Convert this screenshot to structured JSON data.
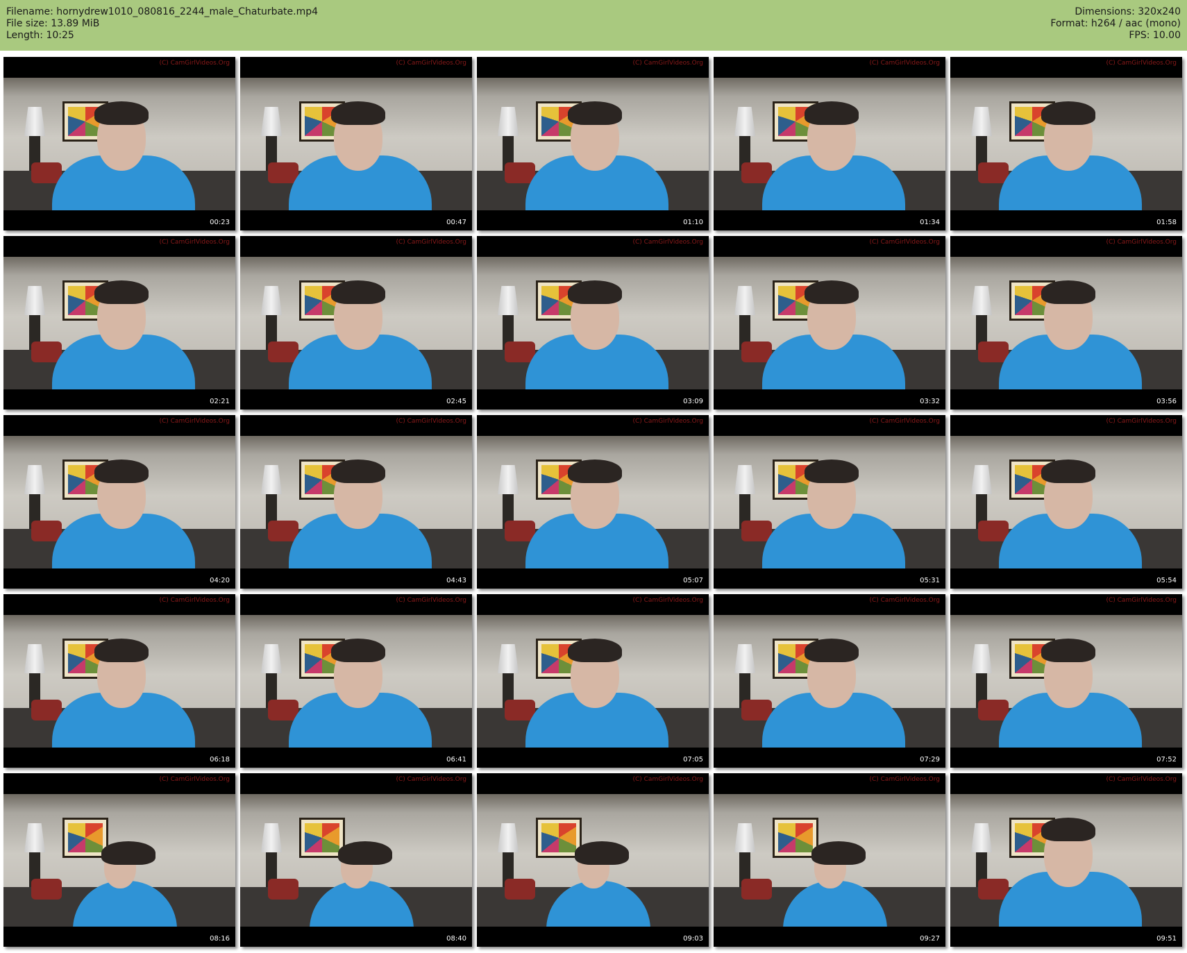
{
  "header": {
    "filename": "Filename: hornydrew1010_080816_2244_male_Chaturbate.mp4",
    "filesize": "File size: 13.89 MiB",
    "length": "Length: 10:25",
    "dimensions": "Dimensions: 320x240",
    "format": "Format: h264 / aac (mono)",
    "fps": "FPS: 10.00"
  },
  "colors": {
    "header_bg": "#a9c97f",
    "shirt": "#2f93d6"
  },
  "watermark": "(C) CamGirlVideos.Org",
  "thumbnails": [
    {
      "time": "00:23"
    },
    {
      "time": "00:47"
    },
    {
      "time": "01:10"
    },
    {
      "time": "01:34"
    },
    {
      "time": "01:58"
    },
    {
      "time": "02:21"
    },
    {
      "time": "02:45"
    },
    {
      "time": "03:09"
    },
    {
      "time": "03:32"
    },
    {
      "time": "03:56"
    },
    {
      "time": "04:20"
    },
    {
      "time": "04:43"
    },
    {
      "time": "05:07"
    },
    {
      "time": "05:31"
    },
    {
      "time": "05:54"
    },
    {
      "time": "06:18"
    },
    {
      "time": "06:41"
    },
    {
      "time": "07:05"
    },
    {
      "time": "07:29"
    },
    {
      "time": "07:52"
    },
    {
      "time": "08:16"
    },
    {
      "time": "08:40"
    },
    {
      "time": "09:03"
    },
    {
      "time": "09:27"
    },
    {
      "time": "09:51"
    }
  ]
}
